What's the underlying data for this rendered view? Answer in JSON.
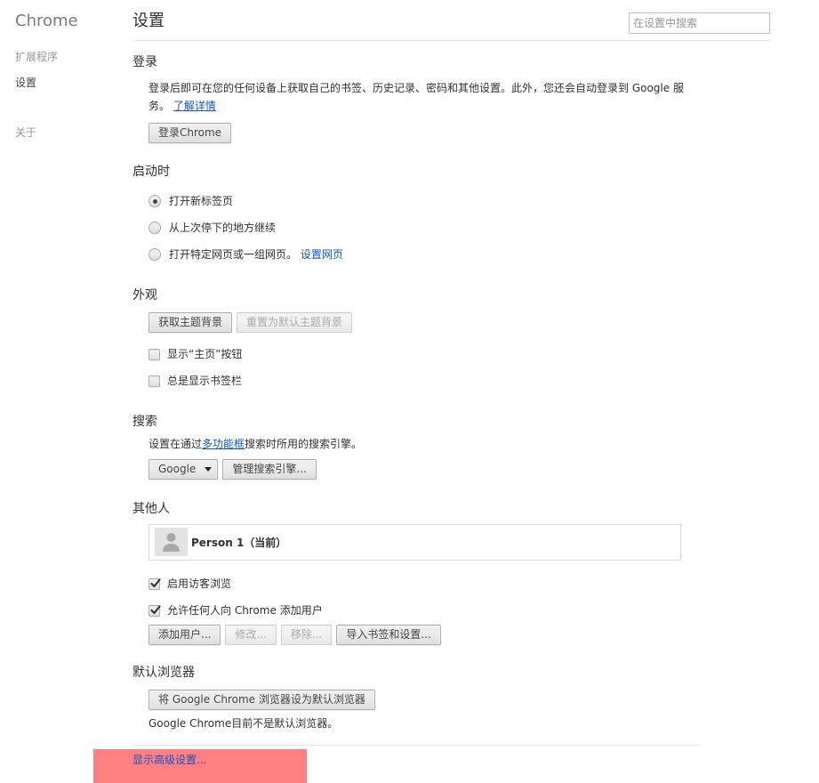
{
  "theme": {
    "link_color": "#1155cc",
    "highlight_color": "#ff8080"
  },
  "sidebar": {
    "brand": "Chrome",
    "items": [
      {
        "label": "扩展程序",
        "active": false
      },
      {
        "label": "设置",
        "active": true
      },
      {
        "label": "关于",
        "active": false
      }
    ]
  },
  "header": {
    "title": "设置",
    "search_placeholder": "在设置中搜索"
  },
  "signin": {
    "heading": "登录",
    "description": "登录后即可在您的任何设备上获取自己的书签、历史记录、密码和其他设置。此外，您还会自动登录到 Google 服务。",
    "learn_more_link": "了解详情",
    "signin_button": "登录Chrome"
  },
  "startup": {
    "heading": "启动时",
    "options": [
      {
        "label": "打开新标签页",
        "checked": true
      },
      {
        "label": "从上次停下的地方继续",
        "checked": false
      },
      {
        "label": "打开特定网页或一组网页。",
        "checked": false,
        "link": "设置网页"
      }
    ]
  },
  "appearance": {
    "heading": "外观",
    "buttons": [
      {
        "label": "获取主题背景",
        "disabled": false
      },
      {
        "label": "重置为默认主题背景",
        "disabled": true
      }
    ],
    "checkboxes": [
      {
        "label": "显示“主页”按钮",
        "checked": false
      },
      {
        "label": "总是显示书签栏",
        "checked": false
      }
    ]
  },
  "search": {
    "heading": "搜索",
    "desc_prefix": "设置在通过",
    "desc_link": "多功能框",
    "desc_suffix": "搜索时所用的搜索引擎。",
    "engine_select": {
      "value": "Google",
      "arrow_icon": "dropdown-arrow-icon"
    },
    "manage_button": "管理搜索引擎..."
  },
  "people": {
    "heading": "其他人",
    "profiles": [
      {
        "name": "Person 1（当前）",
        "avatar_icon": "default-avatar-icon"
      }
    ],
    "checkboxes": [
      {
        "label": "启用访客浏览",
        "checked": true
      },
      {
        "label": "允许任何人向 Chrome 添加用户",
        "checked": true
      }
    ],
    "buttons": [
      {
        "label": "添加用户...",
        "disabled": false
      },
      {
        "label": "修改...",
        "disabled": true
      },
      {
        "label": "移除...",
        "disabled": true
      },
      {
        "label": "导入书签和设置...",
        "disabled": false
      }
    ]
  },
  "default_browser": {
    "heading": "默认浏览器",
    "make_default_button": "将 Google Chrome 浏览器设为默认浏览器",
    "status": "Google Chrome目前不是默认浏览器。"
  },
  "advanced": {
    "show_advanced_link": "显示高级设置..."
  }
}
